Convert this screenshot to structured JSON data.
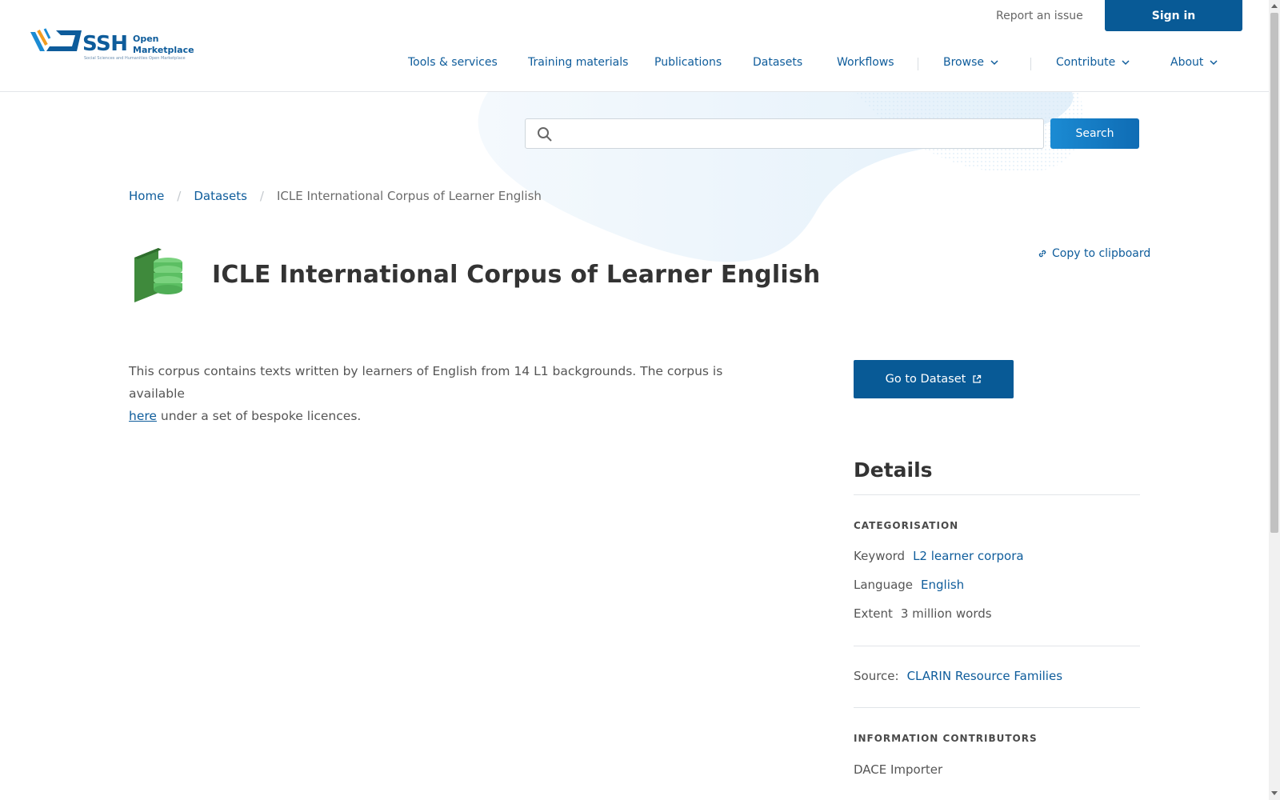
{
  "header": {
    "logo": {
      "ssh": "SSH",
      "open": "Open",
      "marketplace": "Marketplace",
      "subtitle": "Social Sciences and Humanities Open Marketplace"
    },
    "report_issue": "Report an issue",
    "sign_in": "Sign in",
    "nav": [
      {
        "label": "Tools & services"
      },
      {
        "label": "Training materials"
      },
      {
        "label": "Publications"
      },
      {
        "label": "Datasets"
      },
      {
        "label": "Workflows"
      },
      {
        "label": "Browse"
      },
      {
        "label": "Contribute"
      },
      {
        "label": "About"
      }
    ]
  },
  "search": {
    "value": "",
    "placeholder": "",
    "button": "Search"
  },
  "breadcrumb": {
    "home": "Home",
    "section": "Datasets",
    "current": "ICLE International Corpus of Learner English"
  },
  "item": {
    "title": "ICLE International Corpus of Learner English",
    "copy_label": "Copy to clipboard",
    "description_part1": "This corpus contains texts written by learners of English from 14 L1 backgrounds. The corpus is available",
    "description_link": "here",
    "description_part2": "under a set of bespoke licences.",
    "go_button": "Go to Dataset"
  },
  "details": {
    "title": "Details",
    "categorisation_label": "CATEGORISATION",
    "keyword_key": "Keyword",
    "keyword_value": "L2 learner corpora",
    "language_key": "Language",
    "language_value": "English",
    "extent_key": "Extent",
    "extent_value": "3 million words",
    "source_key": "Source:",
    "source_value": "CLARIN Resource Families",
    "contributors_label": "INFORMATION CONTRIBUTORS",
    "contributor": "DACE Importer"
  },
  "colors": {
    "primary": "#085a96",
    "link": "#0e5c9b",
    "search_btn": "#1b8bd3",
    "dataset_icon": "#3f8a3c"
  }
}
